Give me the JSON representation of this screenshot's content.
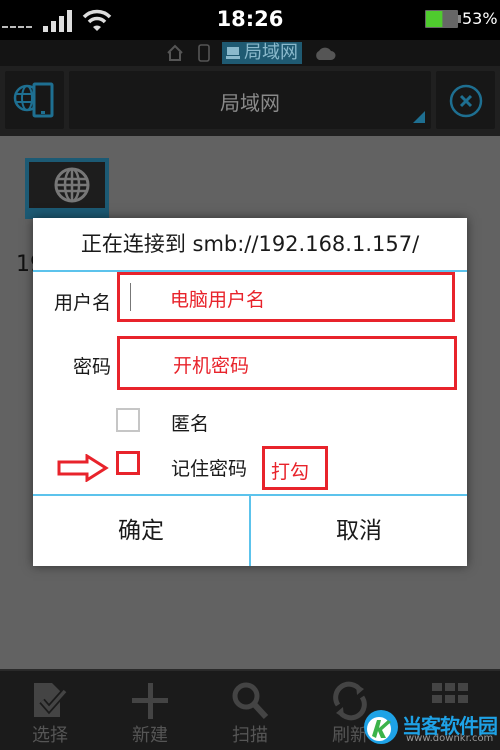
{
  "status_bar": {
    "time": "18:26",
    "battery_percent": "53%",
    "battery_level": 0.53,
    "signal_bars": 4,
    "icons": [
      "signal-icon",
      "wifi-icon",
      "battery-icon"
    ]
  },
  "location_bar": {
    "current": "局域网",
    "icons": [
      "home-icon",
      "phone-icon",
      "lan-icon",
      "cloud-icon"
    ]
  },
  "toolbar": {
    "title": "局域网",
    "left_icon": "network-device-icon",
    "right_icon": "close-circle-icon"
  },
  "content": {
    "server_label": "19"
  },
  "dialog": {
    "title": "正在连接到 smb://192.168.1.157/",
    "username_label": "用户名",
    "username_value": "",
    "username_annotation": "电脑用户名",
    "password_label": "密码",
    "password_value": "",
    "password_annotation": "开机密码",
    "anonymous_label": "匿名",
    "anonymous_checked": false,
    "remember_label": "记住密码",
    "remember_checked": false,
    "remember_annotation": "打勾",
    "ok_label": "确定",
    "cancel_label": "取消"
  },
  "bottom_bar": {
    "items": [
      {
        "label": "选择",
        "icon": "select-icon"
      },
      {
        "label": "新建",
        "icon": "plus-icon"
      },
      {
        "label": "扫描",
        "icon": "search-icon"
      },
      {
        "label": "刷新",
        "icon": "refresh-icon"
      },
      {
        "label": "",
        "icon": "grid-icon"
      }
    ]
  },
  "watermark": {
    "name": "当客软件园",
    "url": "www.downkr.com"
  },
  "colors": {
    "accent": "#5cc3ec",
    "annotation_red": "#e8232b",
    "toolbar_blue": "#1e6f91",
    "watermark_blue": "#1ea2e6"
  }
}
